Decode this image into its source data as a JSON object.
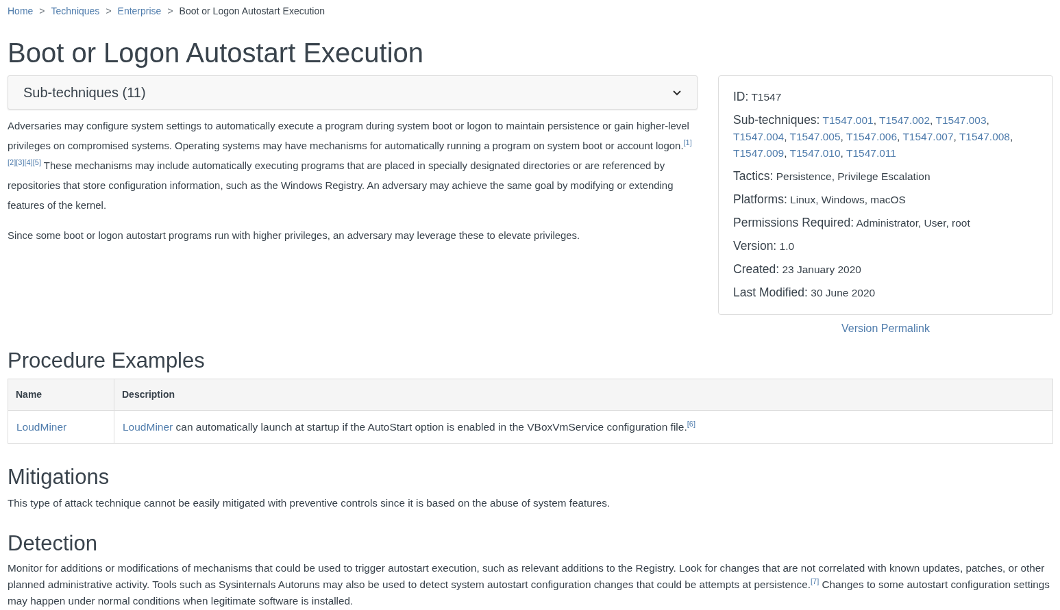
{
  "breadcrumb": [
    {
      "label": "Home",
      "link": true
    },
    {
      "label": "Techniques",
      "link": true
    },
    {
      "label": "Enterprise",
      "link": true
    },
    {
      "label": "Boot or Logon Autostart Execution",
      "link": false
    }
  ],
  "breadcrumb_separator": ">",
  "title": "Boot or Logon Autostart Execution",
  "subtechniques_panel": {
    "label": "Sub-techniques (11)",
    "expanded": false
  },
  "description": [
    {
      "before": "Adversaries may configure system settings to automatically execute a program during system boot or logon to maintain persistence or gain higher-level privileges on compromised systems. Operating systems may have mechanisms for automatically running a program on system boot or account logon.",
      "citations": [
        "[1]",
        "[2]",
        "[3]",
        "[4]",
        "[5]"
      ],
      "after": " These mechanisms may include automatically executing programs that are placed in specially designated directories or are referenced by repositories that store configuration information, such as the Windows Registry. An adversary may achieve the same goal by modifying or extending features of the kernel."
    },
    {
      "before": "Since some boot or logon autostart programs run with higher privileges, an adversary may leverage these to elevate privileges."
    }
  ],
  "info_separator": ",",
  "info_card": [
    {
      "label": "ID:",
      "values": [
        {
          "text": "T1547",
          "link": false
        }
      ]
    },
    {
      "label": "Sub-techniques:",
      "values": [
        {
          "text": "T1547.001",
          "link": true
        },
        {
          "text": "T1547.002",
          "link": true
        },
        {
          "text": "T1547.003",
          "link": true
        },
        {
          "text": "T1547.004",
          "link": true
        },
        {
          "text": "T1547.005",
          "link": true
        },
        {
          "text": "T1547.006",
          "link": true
        },
        {
          "text": "T1547.007",
          "link": true
        },
        {
          "text": "T1547.008",
          "link": true
        },
        {
          "text": "T1547.009",
          "link": true
        },
        {
          "text": "T1547.010",
          "link": true
        },
        {
          "text": "T1547.011",
          "link": true
        }
      ]
    },
    {
      "label": "Tactics:",
      "values": [
        {
          "text": "Persistence, Privilege Escalation",
          "link": false
        }
      ]
    },
    {
      "label": "Platforms:",
      "values": [
        {
          "text": "Linux, Windows, macOS",
          "link": false
        }
      ]
    },
    {
      "label": "Permissions Required:",
      "values": [
        {
          "text": "Administrator, User, root",
          "link": false
        }
      ]
    },
    {
      "label": "Version:",
      "values": [
        {
          "text": "1.0",
          "link": false
        }
      ]
    },
    {
      "label": "Created:",
      "values": [
        {
          "text": "23 January 2020",
          "link": false
        }
      ]
    },
    {
      "label": "Last Modified:",
      "values": [
        {
          "text": "30 June 2020",
          "link": false
        }
      ]
    }
  ],
  "version_permalink": "Version Permalink",
  "procedure_examples": {
    "heading": "Procedure Examples",
    "columns": [
      "Name",
      "Description"
    ],
    "rows": [
      {
        "name": "LoudMiner",
        "description_link": "LoudMiner",
        "description": " can automatically launch at startup if the AutoStart option is enabled in the VBoxVmService configuration file.",
        "citation": "[6]"
      }
    ]
  },
  "mitigations": {
    "heading": "Mitigations",
    "text": "This type of attack technique cannot be easily mitigated with preventive controls since it is based on the abuse of system features."
  },
  "detection": {
    "heading": "Detection",
    "before": "Monitor for additions or modifications of mechanisms that could be used to trigger autostart execution, such as relevant additions to the Registry. Look for changes that are not correlated with known updates, patches, or other planned administrative activity. Tools such as Sysinternals Autoruns may also be used to detect system autostart configuration changes that could be attempts at persistence.",
    "citations": [
      "[7]"
    ],
    "after": " Changes to some autostart configuration settings may happen under normal conditions when legitimate software is installed."
  }
}
